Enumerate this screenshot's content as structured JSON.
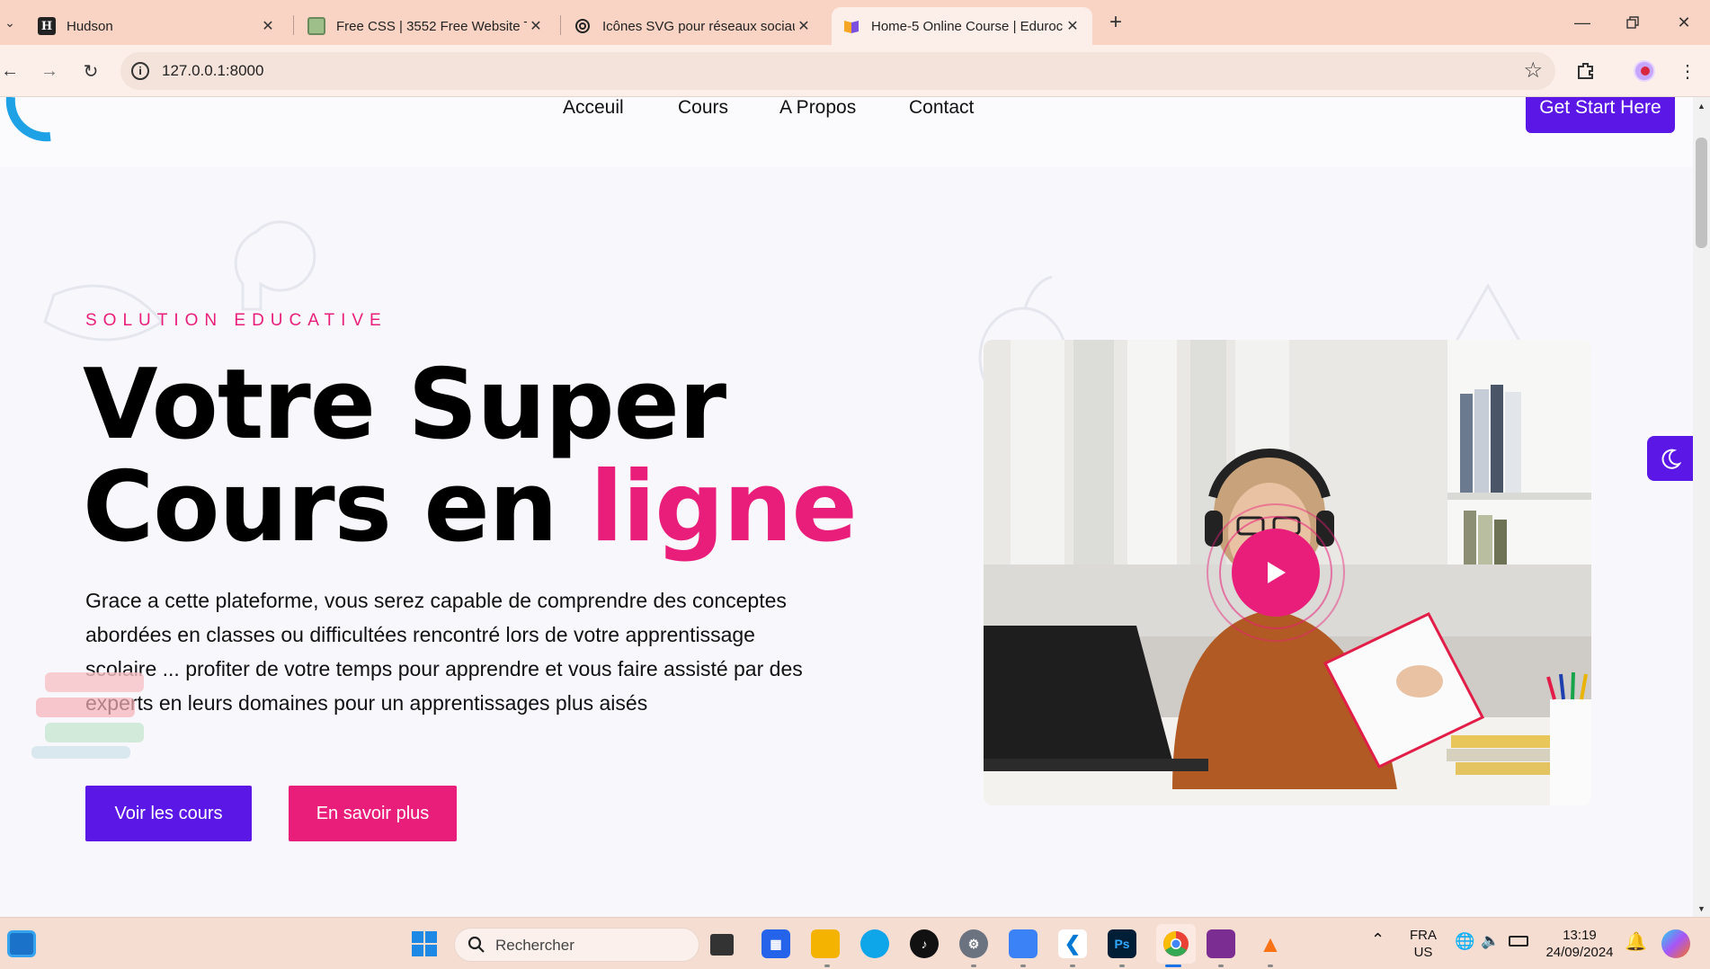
{
  "browser": {
    "tabs": [
      {
        "title": "Hudson",
        "favicon": "H"
      },
      {
        "title": "Free CSS | 3552 Free Website Te",
        "favicon": "css"
      },
      {
        "title": "Icônes SVG pour réseaux sociau",
        "favicon": "gear"
      },
      {
        "title": "Home-5 Online Course | Eduroc",
        "favicon": "book"
      }
    ],
    "url": "127.0.0.1:8000"
  },
  "nav": {
    "links": [
      "Acceuil",
      "Cours",
      "A Propos",
      "Contact"
    ],
    "cta": "Get Start Here"
  },
  "hero": {
    "tagline": "SOLUTION EDUCATIVE",
    "title_line1": "Votre Super",
    "title_line2_plain": "Cours en ",
    "title_line2_highlight": "ligne",
    "description": "Grace a cette plateforme, vous serez capable de comprendre des conceptes abordées en classes ou difficultées rencontré lors de votre apprentissage scolaire ... profiter de votre temps pour apprendre et vous faire assisté par des experts en leurs domaines pour un apprentissages plus aisés",
    "primary_button": "Voir les cours",
    "secondary_button": "En savoir plus"
  },
  "taskbar": {
    "search_placeholder": "Rechercher",
    "language": "FRA",
    "layout": "US",
    "time": "13:19",
    "date": "24/09/2024"
  },
  "colors": {
    "accent_purple": "#5b17e6",
    "accent_pink": "#e91e7a",
    "tab_strip": "#f9d3c3"
  }
}
